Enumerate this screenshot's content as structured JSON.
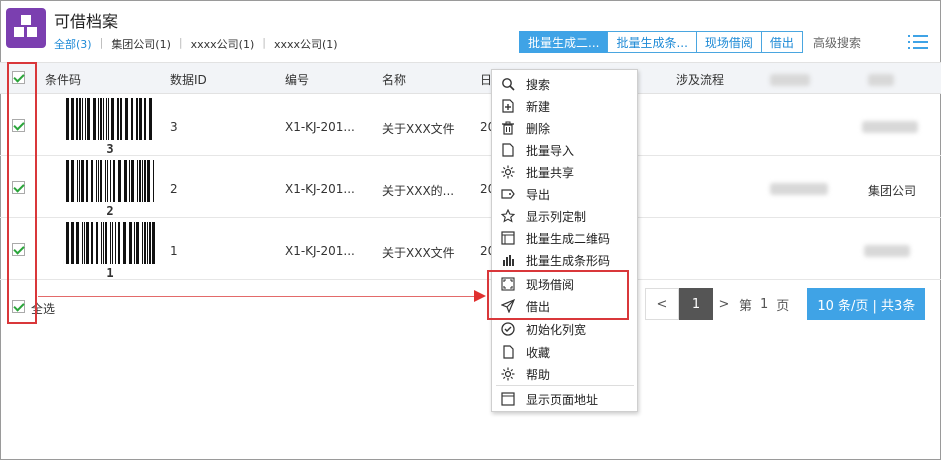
{
  "app": {
    "title": "可借档案",
    "filters": [
      {
        "label": "全部(3)",
        "active": true
      },
      {
        "label": "集团公司(1)",
        "active": false
      },
      {
        "label": "xxxx公司(1)",
        "active": false
      },
      {
        "label": "xxxx公司(1)",
        "active": false
      }
    ]
  },
  "toolbar": {
    "buttons": [
      "批量生成二...",
      "批量生成条...",
      "现场借阅",
      "借出"
    ],
    "advanced_search": "高级搜索"
  },
  "table": {
    "headers": [
      "条件码",
      "数据ID",
      "编号",
      "名称",
      "日",
      "涉及流程"
    ],
    "rows": [
      {
        "barcode_num": "3",
        "id": "3",
        "code": "X1-KJ-201...",
        "name": "关于XXX文件",
        "date": "20",
        "company": ""
      },
      {
        "barcode_num": "2",
        "id": "2",
        "code": "X1-KJ-201...",
        "name": "关于XXX的...",
        "date": "20",
        "company": "集团公司"
      },
      {
        "barcode_num": "1",
        "id": "1",
        "code": "X1-KJ-201...",
        "name": "关于XXX文件",
        "date": "20",
        "company": ""
      }
    ],
    "select_all": "全选"
  },
  "pager": {
    "prev": "<",
    "current": "1",
    "next": ">",
    "page_label_1": "第",
    "page_number": "1",
    "page_label_2": "页",
    "size_label": "10  条/页 | 共3条"
  },
  "context_menu": {
    "items": [
      {
        "label": "搜索",
        "icon": "search-icon"
      },
      {
        "label": "新建",
        "icon": "new-file-icon"
      },
      {
        "label": "删除",
        "icon": "trash-icon"
      },
      {
        "label": "批量导入",
        "icon": "import-icon"
      },
      {
        "label": "批量共享",
        "icon": "share-icon"
      },
      {
        "label": "导出",
        "icon": "export-icon"
      },
      {
        "label": "显示列定制",
        "icon": "star-icon"
      },
      {
        "label": "批量生成二维码",
        "icon": "qrcode-icon"
      },
      {
        "label": "批量生成条形码",
        "icon": "barcode-icon"
      },
      {
        "label": "现场借阅",
        "icon": "expand-icon"
      },
      {
        "label": "借出",
        "icon": "send-icon"
      },
      {
        "label": "初始化列宽",
        "icon": "check-circle-icon"
      },
      {
        "label": "收藏",
        "icon": "bookmark-icon"
      },
      {
        "label": "帮助",
        "icon": "sun-icon"
      },
      {
        "label": "显示页面地址",
        "icon": "window-icon"
      }
    ]
  },
  "colors": {
    "accent": "#3fa3e6",
    "logo": "#7b3fb0",
    "highlight_box": "#d9373a"
  }
}
